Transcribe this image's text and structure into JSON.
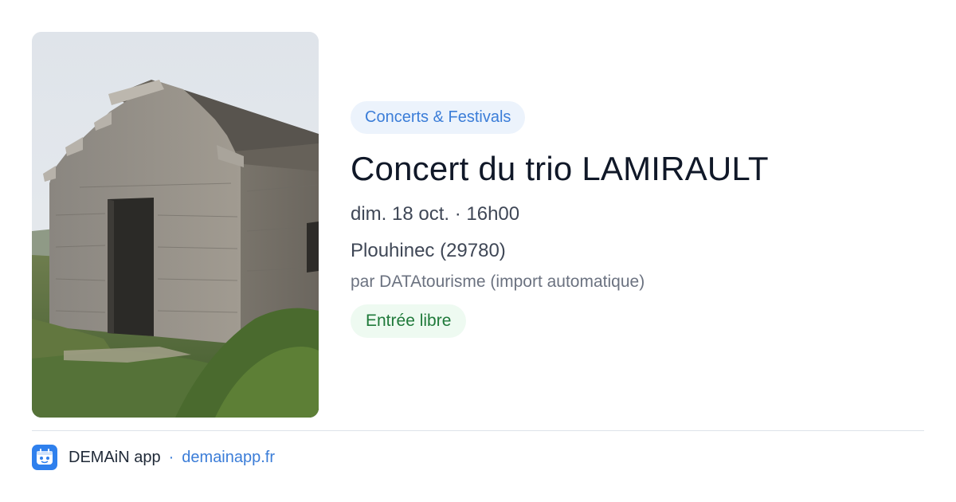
{
  "event": {
    "image_alt": "Stone hut with stepped gable roof on a grassy coast",
    "category": "Concerts & Festivals",
    "title": "Concert du trio LAMIRAULT",
    "datetime": "dim. 18 oct. · 16h00",
    "location": "Plouhinec (29780)",
    "source": "par DATAtourisme (import automatique)",
    "price": "Entrée libre"
  },
  "footer": {
    "app_name": "DEMAiN app",
    "separator": "·",
    "url": "demainapp.fr",
    "logo_icon": "demain-app-logo-icon"
  },
  "colors": {
    "accent": "#3b7dd8",
    "category_bg": "#ecf3fc",
    "price_text": "#1f7a3a",
    "price_bg": "#eefaf1",
    "title": "#101828"
  }
}
